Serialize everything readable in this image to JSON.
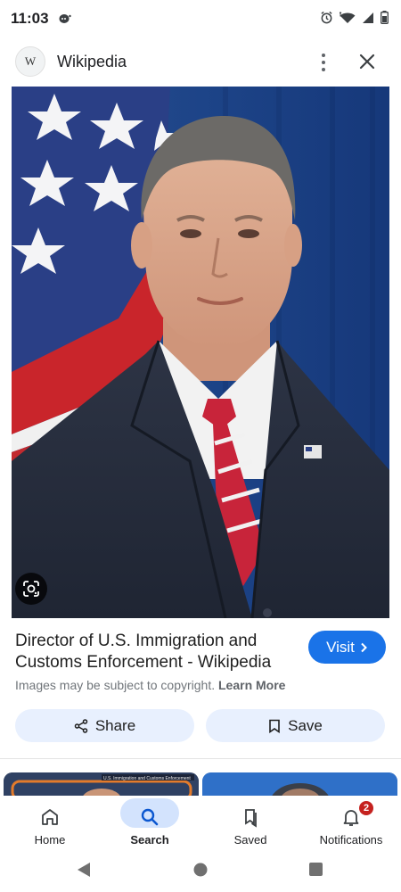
{
  "status_bar": {
    "time": "11:03"
  },
  "header": {
    "site_icon_letter": "W",
    "site_name": "Wikipedia"
  },
  "result": {
    "title": "Director of U.S. Immigration and Customs Enforcement - Wikipedia",
    "visit_label": "Visit",
    "copyright_text": "Images may be subject to copyright.",
    "learn_more_label": "Learn More"
  },
  "actions": {
    "share_label": "Share",
    "save_label": "Save"
  },
  "related": {
    "thumb1_caption": "U.S. Immigration and Customs Enforcement"
  },
  "bottom_nav": {
    "items": [
      {
        "label": "Home",
        "icon": "home-icon"
      },
      {
        "label": "Search",
        "icon": "search-icon",
        "active": true
      },
      {
        "label": "Saved",
        "icon": "saved-icon"
      },
      {
        "label": "Notifications",
        "icon": "bell-icon",
        "badge": "2"
      }
    ]
  },
  "colors": {
    "accent": "#1a73e8",
    "action_bg": "#e8f0fe",
    "active_pill": "#d3e3fd",
    "badge": "#c5221f"
  }
}
